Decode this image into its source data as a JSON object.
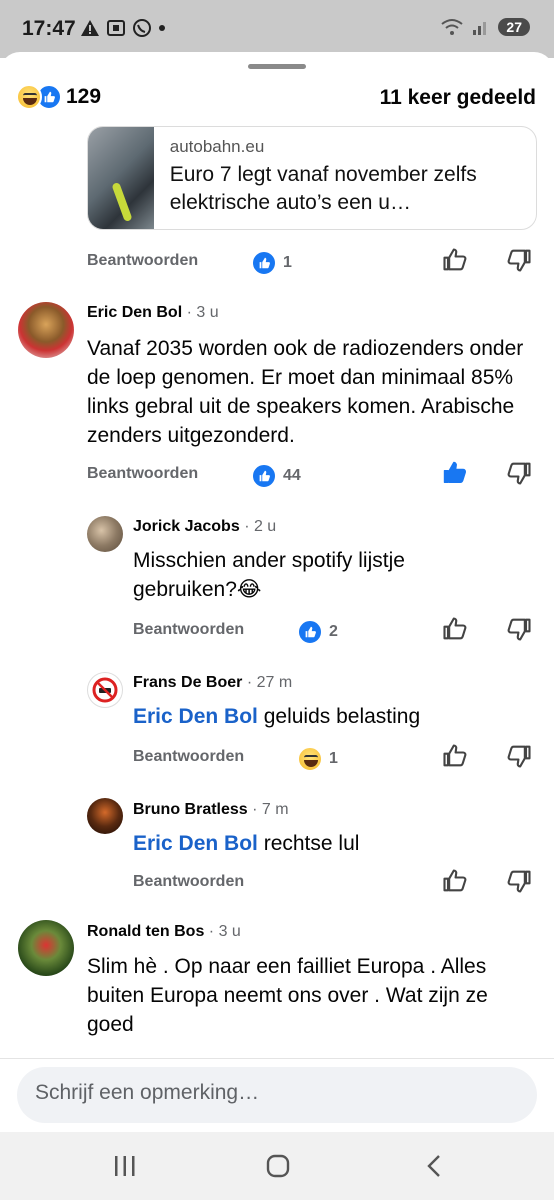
{
  "status": {
    "time": "17:47",
    "battery": "27"
  },
  "post_summary": {
    "reaction_count": "129",
    "shares_label": "11 keer gedeeld"
  },
  "link_preview": {
    "domain": "autobahn.eu",
    "title": "Euro 7 legt vanaf november zelfs elektrische auto’s een u…"
  },
  "reply_label": "Beantwoorden",
  "comments": [
    {
      "id": "c0",
      "reaction_count": "1",
      "reaction_type": "like"
    },
    {
      "id": "c1",
      "author": "Eric Den Bol",
      "time": "· 3 u",
      "text": "Vanaf 2035 worden ook de radiozenders onder de loep genomen. Er moet dan minimaal 85% links gebral uit de speakers komen. Arabische zenders uitgezonderd.",
      "reaction_count": "44",
      "reaction_type": "like",
      "liked": true
    },
    {
      "id": "c2",
      "author": "Jorick Jacobs",
      "time": "· 2 u",
      "text": "Misschien ander spotify lijstje gebruiken?😂",
      "reaction_count": "2",
      "reaction_type": "like"
    },
    {
      "id": "c3",
      "author": "Frans De Boer",
      "time": "· 27 m",
      "mention": "Eric Den Bol",
      "text": " geluids belasting",
      "reaction_count": "1",
      "reaction_type": "haha"
    },
    {
      "id": "c4",
      "author": "Bruno Bratless",
      "time": "· 7 m",
      "mention": "Eric Den Bol",
      "text": " rechtse lul"
    },
    {
      "id": "c5",
      "author": "Ronald ten Bos",
      "time": "· 3 u",
      "text": "Slim hè . Op naar een failliet Europa . Alles buiten Europa neemt ons over . Wat zijn ze goed"
    }
  ],
  "composer": {
    "placeholder": "Schrijf een opmerking…"
  },
  "colors": {
    "accent": "#1877f2",
    "mention": "#1a62c9",
    "muted": "#65676b"
  }
}
